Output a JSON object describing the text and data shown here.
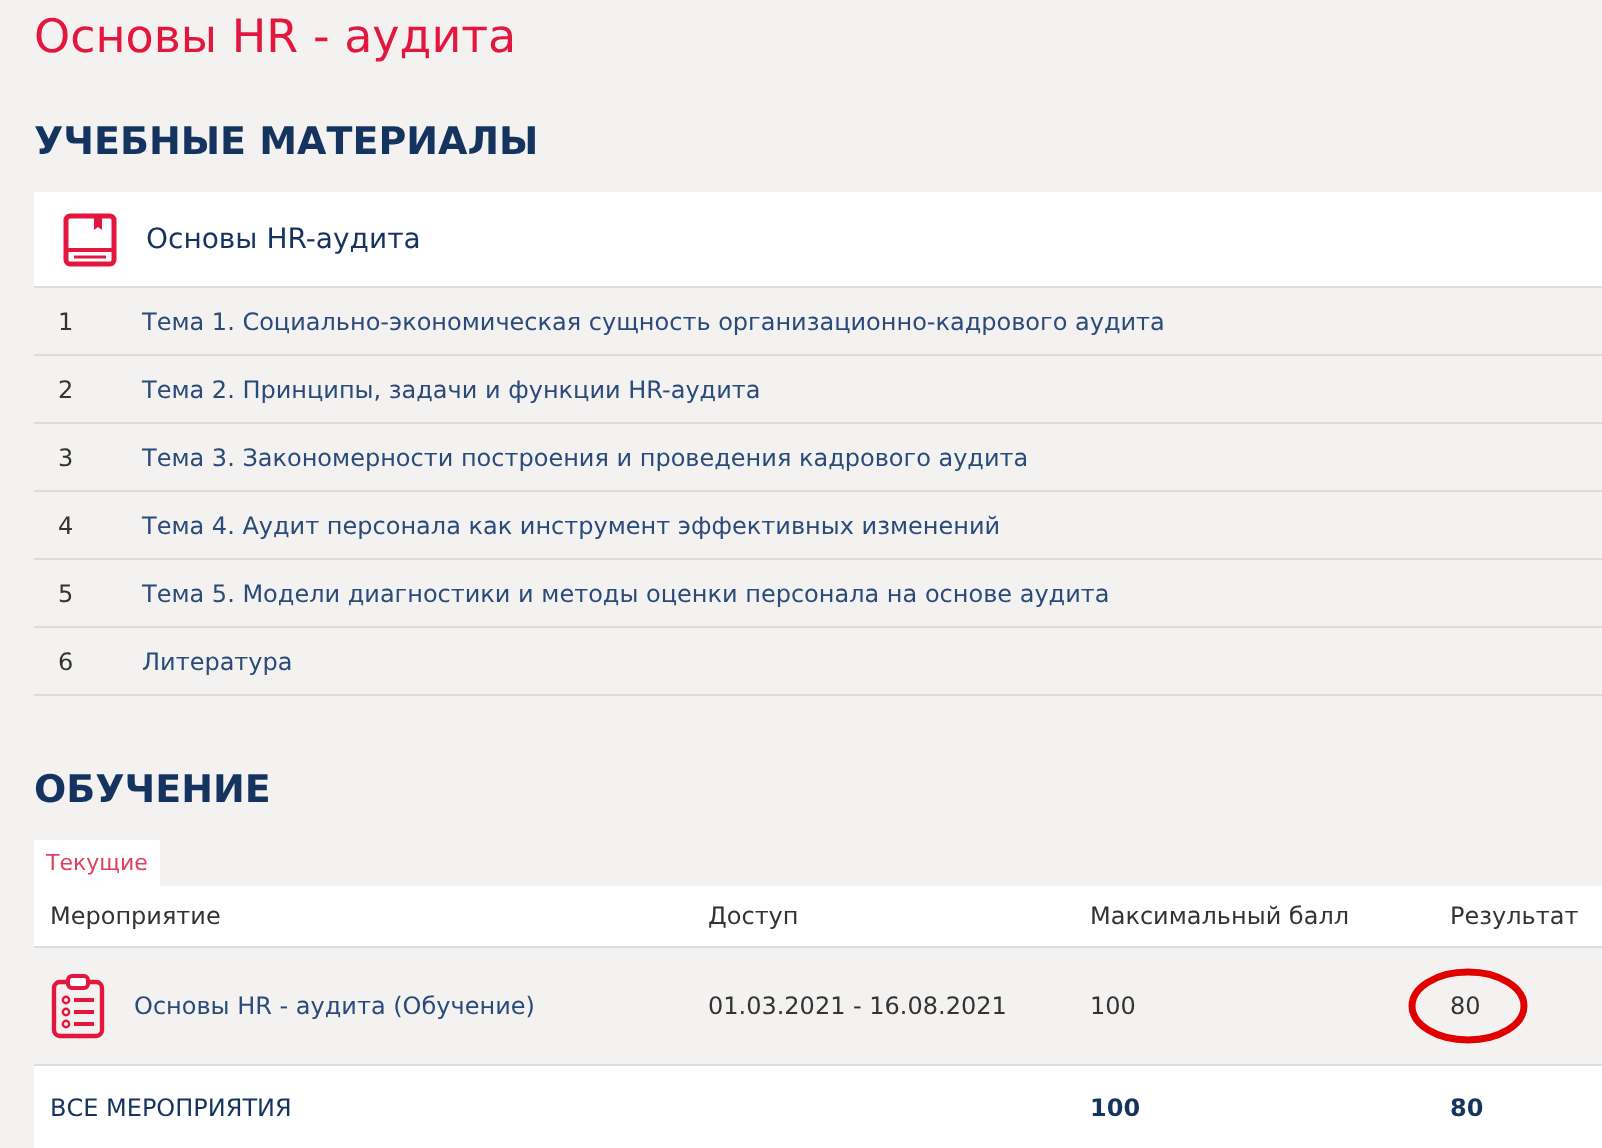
{
  "title": "Основы HR - аудита",
  "materials": {
    "heading": "УЧЕБНЫЕ МАТЕРИАЛЫ",
    "course": "Основы HR-аудита",
    "items": [
      {
        "number": "1",
        "label": "Тема 1. Социально-экономическая сущность организационно-кадрового аудита"
      },
      {
        "number": "2",
        "label": "Тема 2. Принципы, задачи и функции HR-аудита"
      },
      {
        "number": "3",
        "label": "Тема 3. Закономерности построения и проведения кадрового аудита"
      },
      {
        "number": "4",
        "label": "Тема 4. Аудит персонала как инструмент эффективных изменений"
      },
      {
        "number": "5",
        "label": "Тема 5. Модели диагностики и методы оценки персонала на основе аудита"
      },
      {
        "number": "6",
        "label": "Литература"
      }
    ]
  },
  "training": {
    "heading": "ОБУЧЕНИЕ",
    "tabs": [
      {
        "label": "Текущие",
        "selected": true
      }
    ],
    "table": {
      "columns": [
        "Мероприятие",
        "Доступ",
        "Максимальный балл",
        "Результат"
      ],
      "rows": [
        {
          "event": "Основы HR - аудита (Обучение)",
          "access": "01.03.2021 - 16.08.2021",
          "max_score": "100",
          "result": "80",
          "result_circled": true
        }
      ],
      "total": {
        "label": "ВСЕ МЕРОПРИЯТИЯ",
        "max_score": "100",
        "result": "80"
      }
    }
  }
}
